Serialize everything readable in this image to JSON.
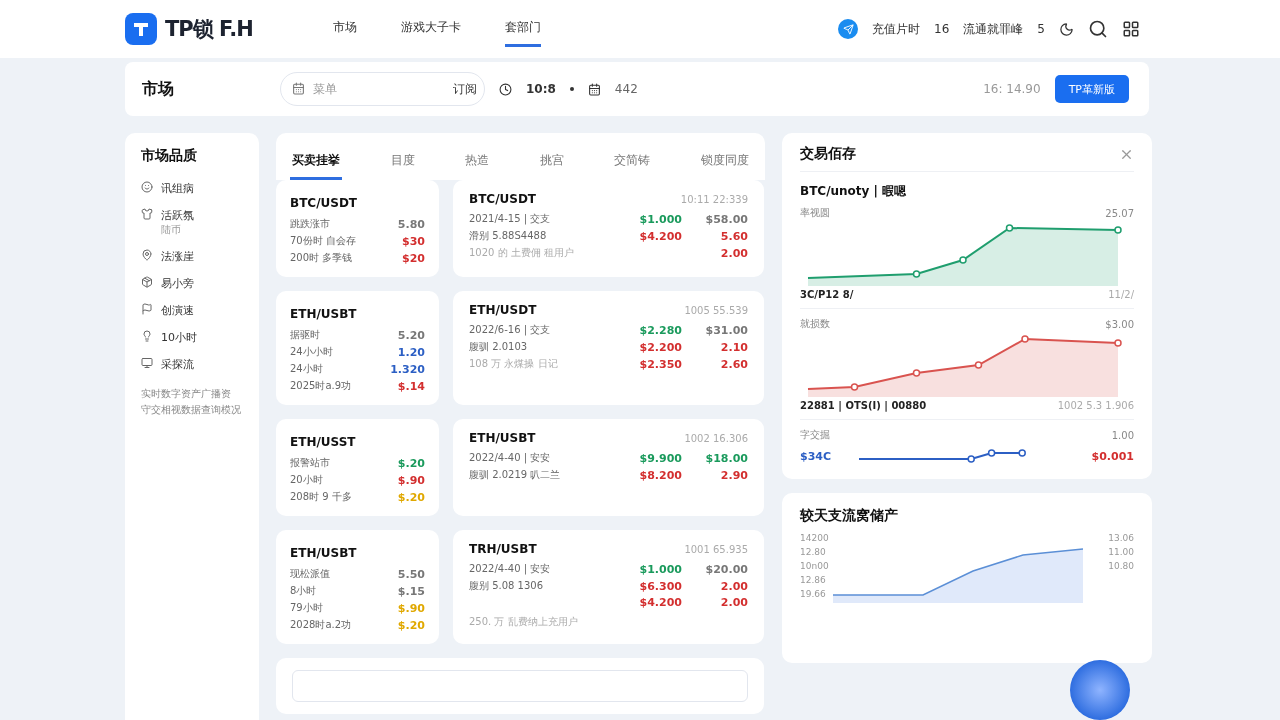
{
  "header": {
    "logo_text": "TP锁 F.H",
    "nav": [
      {
        "label": "市场",
        "selected": false
      },
      {
        "label": "游戏大子卡",
        "selected": false
      },
      {
        "label": "套部门",
        "selected": true
      }
    ],
    "stats": [
      {
        "label": "充值片时",
        "value": "16"
      },
      {
        "label": "流通就罪峰",
        "value": "5"
      }
    ]
  },
  "toolbar": {
    "title": "市场",
    "search": {
      "placeholder": "菜单",
      "action": "订阅"
    },
    "time": "10:8",
    "count": "442",
    "price": "16: 14.90",
    "button": "TP革新版"
  },
  "sidebar": {
    "title": "市场品质",
    "items": [
      {
        "label": "讯组病"
      },
      {
        "label": "活跃氛",
        "sub": "陆币"
      },
      {
        "label": "法涨崖"
      },
      {
        "label": "易小旁"
      },
      {
        "label": "创演速"
      },
      {
        "label": "10小时"
      },
      {
        "label": "采探流"
      }
    ],
    "note_lines": [
      "实时数字资产广播资",
      "守交相视数据查询模况"
    ]
  },
  "tabs": [
    {
      "label": "买卖挂挙",
      "selected": true
    },
    {
      "label": "目度",
      "selected": false
    },
    {
      "label": "热造",
      "selected": false
    },
    {
      "label": "挑宫",
      "selected": false
    },
    {
      "label": "交简铸",
      "selected": false
    },
    {
      "label": "锁度同度",
      "selected": false
    }
  ],
  "markets": [
    {
      "summary": {
        "pair": "BTC/USDT",
        "rows": [
          {
            "label": "跳跌涨市",
            "value": "5.80",
            "color": "#777777"
          },
          {
            "label": "70份时 自会存",
            "value": "$30",
            "color": "#d32f2f"
          },
          {
            "label": "200时 多季钱",
            "value": "$20",
            "color": "#d32f2f"
          }
        ]
      },
      "detail": {
        "pair": "BTC/USDT",
        "time": "10:11 22:339",
        "rows": [
          {
            "label": "2021/4-15 | 交支",
            "price": {
              "text": "$1.000",
              "color": "#1a9a5c"
            },
            "change": {
              "text": "$58.00",
              "color": "#777777"
            }
          },
          {
            "label": "滑别 5.88S4488",
            "price": {
              "text": "$4.200",
              "color": "#d32f2f"
            },
            "change": {
              "text": "5.60",
              "color": "#d32f2f"
            }
          },
          {
            "label": "1020 的 土费佣 租用户",
            "change": {
              "text": "2.00",
              "color": "#d32f2f"
            }
          }
        ]
      }
    },
    {
      "summary": {
        "pair": "ETH/USBT",
        "rows": [
          {
            "label": "据驱时",
            "value": "5.20",
            "color": "#777777"
          },
          {
            "label": "24小小时",
            "value": "1.20",
            "color": "#2c5fc4"
          },
          {
            "label": "24小时",
            "value": "1.320",
            "color": "#2c5fc4"
          },
          {
            "label": "2025时a.9功",
            "value": "$.14",
            "color": "#d32f2f"
          }
        ]
      },
      "detail": {
        "pair": "ETH/USDT",
        "time": "1005 55.539",
        "rows": [
          {
            "label": "2022/6-16 | 交支",
            "price": {
              "text": "$2.280",
              "color": "#1a9a5c"
            },
            "change": {
              "text": "$31.00",
              "color": "#777777"
            }
          },
          {
            "label": "腹驯 2.0103",
            "price": {
              "text": "$2.200",
              "color": "#d32f2f"
            },
            "change": {
              "text": "2.10",
              "color": "#d32f2f"
            }
          },
          {
            "label": "108 万 永煤操 日记",
            "price": {
              "text": "$2.350",
              "color": "#d32f2f"
            },
            "change": {
              "text": "2.60",
              "color": "#d32f2f"
            }
          }
        ]
      }
    },
    {
      "summary": {
        "pair": "ETH/USST",
        "rows": [
          {
            "label": "报警站市",
            "value": "$.20",
            "color": "#1a9a5c"
          },
          {
            "label": "20小时",
            "value": "$.90",
            "color": "#d32f2f"
          },
          {
            "label": "208时 9 千多",
            "value": "$.20",
            "color": "#e0a800"
          }
        ]
      },
      "detail": {
        "pair": "ETH/USBT",
        "time": "1002 16.306",
        "rows": [
          {
            "label": "2022/4-40 | 安安",
            "price": {
              "text": "$9.900",
              "color": "#1a9a5c"
            },
            "change": {
              "text": "$18.00",
              "color": "#1a9a5c"
            }
          },
          {
            "label": "腹驯 2.0219  叭二兰",
            "price": {
              "text": "$8.200",
              "color": "#d32f2f"
            },
            "change": {
              "text": "2.90",
              "color": "#d32f2f"
            }
          }
        ]
      }
    },
    {
      "summary": {
        "pair": "ETH/USBT",
        "rows": [
          {
            "label": "现松派值",
            "value": "5.50",
            "color": "#777777"
          },
          {
            "label": "8小时",
            "value": "$.15",
            "color": "#777777"
          },
          {
            "label": "79小时",
            "value": "$.90",
            "color": "#e0a800"
          },
          {
            "label": "2028时a.2功",
            "value": "$.20",
            "color": "#e0a800"
          }
        ]
      },
      "detail": {
        "pair": "TRH/USBT",
        "time": "1001 65.935",
        "rows": [
          {
            "label": "2022/4-40 | 安安",
            "price": {
              "text": "$1.000",
              "color": "#1a9a5c"
            },
            "change": {
              "text": "$20.00",
              "color": "#777777"
            }
          },
          {
            "label": "腹别 5.08 1306",
            "price": {
              "text": "$6.300",
              "color": "#d32f2f"
            },
            "change": {
              "text": "2.00",
              "color": "#d32f2f"
            }
          },
          {
            "price": {
              "text": "$4.200",
              "color": "#d32f2f"
            },
            "change": {
              "text": "2.00",
              "color": "#d32f2f"
            }
          }
        ],
        "footnote": "250. 万 乱费纳上充用户"
      }
    }
  ],
  "panel": {
    "title": "交易佰存",
    "subtitle": "BTC/unoty | 暇嗯",
    "charts": [
      {
        "kind": "area",
        "color": "#1f9e6e",
        "label": "率视圆",
        "value": "25.07",
        "foot_left": "3C/P12 8/",
        "foot_right": "11/2/"
      },
      {
        "kind": "area",
        "color": "#d9534f",
        "label": "就损数",
        "value": "$3.00",
        "foot_left": "22881 | OTS(I) | 00880",
        "foot_right": "1002 5.3 1.906"
      },
      {
        "kind": "line",
        "color": "#2c5fc4",
        "label": "字交掘",
        "value": "1.00",
        "start": "$34C",
        "end": "$0.001"
      }
    ]
  },
  "assets": {
    "title": "较天支流窝储产",
    "left_ticks": [
      "14200",
      "12.80",
      "10n00",
      "12.86",
      "19.66"
    ],
    "right_ticks": [
      "13.06",
      "11.00",
      "10.80"
    ]
  }
}
